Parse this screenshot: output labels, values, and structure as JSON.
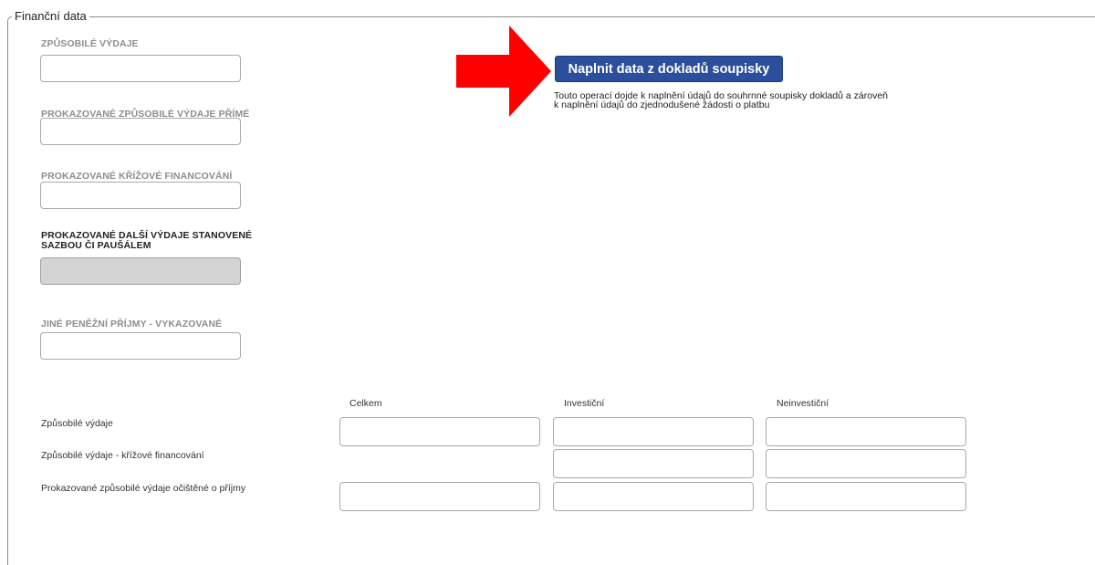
{
  "section": {
    "legend": "Finanční data"
  },
  "fields": [
    {
      "label": "ZPŮSOBILÉ VÝDAJE",
      "value": ""
    },
    {
      "label": "PROKAZOVANÉ ZPŮSOBILÉ VÝDAJE PŘÍMÉ",
      "value": ""
    },
    {
      "label": "PROKAZOVANÉ KŘÍŽOVÉ FINANCOVÁNÍ",
      "value": ""
    },
    {
      "label_line1": "PROKAZOVANÉ DALŠÍ VÝDAJE STANOVENÉ",
      "label_line2": "SAZBOU ČI PAUŠÁLEM",
      "value": ""
    },
    {
      "label": "JINÉ PENĚŽNÍ PŘÍJMY - VYKAZOVANÉ",
      "value": ""
    }
  ],
  "action": {
    "button_label": "Naplnit data z dokladů soupisky",
    "note_line1": "Touto operací dojde k naplnění údajů do souhrnné soupisky dokladů a zároveň",
    "note_line2": "k naplnění údajů do zjednodušené žádosti o platbu",
    "arrow_color": "#ff0000"
  },
  "table": {
    "columns": [
      "Celkem",
      "Investiční",
      "Neinvestiční"
    ],
    "rows": [
      {
        "label": "Způsobilé výdaje",
        "values": [
          "",
          "",
          ""
        ]
      },
      {
        "label": "Způsobilé výdaje - křížové financování",
        "values": [
          "",
          ""
        ]
      },
      {
        "label": "Prokazované způsobilé výdaje očištěné o příjmy",
        "values": [
          "",
          "",
          ""
        ]
      }
    ]
  },
  "colors": {
    "button_bg": "#2b4f9c",
    "disabled_input_bg": "#d4d4d4"
  }
}
